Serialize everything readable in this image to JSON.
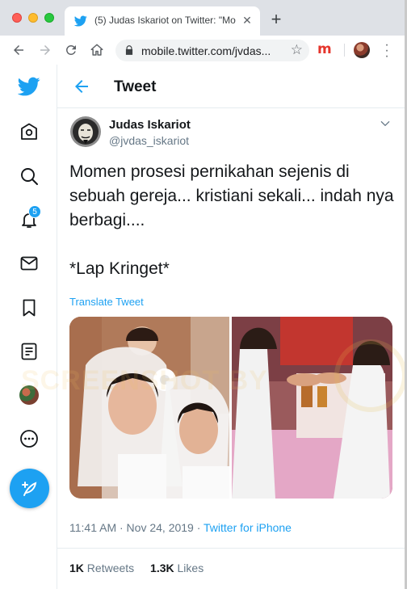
{
  "browser": {
    "tab_title": "(5) Judas Iskariot on Twitter: \"Mo",
    "url": "mobile.twitter.com/jvdas...",
    "ext_letter": "m"
  },
  "sidebar": {
    "notification_count": "5"
  },
  "header": {
    "title": "Tweet"
  },
  "tweet": {
    "author_name": "Judas Iskariot",
    "author_handle": "@jvdas_iskariot",
    "text": "Momen prosesi pernikahan sejenis di sebuah gereja... kristiani sekali... indah nya berbagi....\n\n*Lap Kringet*",
    "translate_label": "Translate Tweet",
    "time": "11:41 AM · Nov 24, 2019 · ",
    "source": "Twitter for iPhone",
    "retweets_count": "1K",
    "retweets_label": "Retweets",
    "likes_count": "1.3K",
    "likes_label": "Likes"
  },
  "watermark": {
    "text": "SCREENSHOT BY"
  },
  "colors": {
    "brand": "#1da1f2",
    "text": "#14171a",
    "muted": "#657786"
  }
}
